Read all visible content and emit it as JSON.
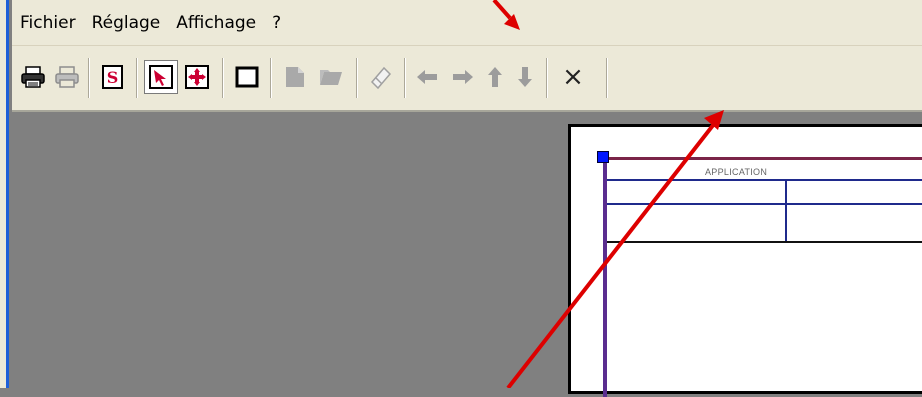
{
  "menu": {
    "items": [
      "Fichier",
      "Réglage",
      "Affichage",
      "?"
    ]
  },
  "toolbar": {
    "buttons": [
      {
        "icon": "printer-icon"
      },
      {
        "icon": "printer-disabled-icon"
      },
      {
        "icon": "script-s-icon"
      },
      {
        "icon": "select-arrow-icon",
        "pressed": true
      },
      {
        "icon": "move-arrows-icon"
      },
      {
        "icon": "rectangle-icon"
      },
      {
        "icon": "page-icon"
      },
      {
        "icon": "folder-icon"
      },
      {
        "icon": "eraser-icon"
      },
      {
        "icon": "arrow-left-icon"
      },
      {
        "icon": "arrow-right-icon"
      },
      {
        "icon": "arrow-up-icon"
      },
      {
        "icon": "arrow-down-icon"
      },
      {
        "icon": "close-icon"
      }
    ],
    "close_glyph": "×"
  },
  "document": {
    "header_label": "APPLICATION"
  },
  "colors": {
    "annotation_arrow": "#dd0000",
    "frame_border": "#1f2a8c",
    "selection_handle": "#0016ff"
  }
}
